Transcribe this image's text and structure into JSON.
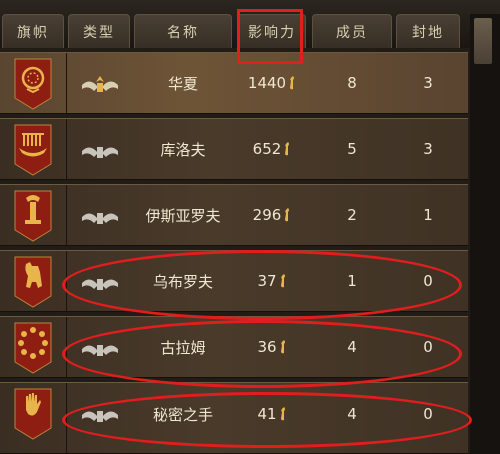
{
  "header": {
    "col_banner": "旗帜",
    "col_type": "类型",
    "col_name": "名称",
    "col_influence": "影响力",
    "col_members": "成员",
    "col_fiefs": "封地"
  },
  "rows": [
    {
      "name": "华夏",
      "influence": "1440",
      "members": "8",
      "fiefs": "3"
    },
    {
      "name": "库洛夫",
      "influence": "652",
      "members": "5",
      "fiefs": "3"
    },
    {
      "name": "伊斯亚罗夫",
      "influence": "296",
      "members": "2",
      "fiefs": "1"
    },
    {
      "name": "乌布罗夫",
      "influence": "37",
      "members": "1",
      "fiefs": "0"
    },
    {
      "name": "古拉姆",
      "influence": "36",
      "members": "4",
      "fiefs": "0"
    },
    {
      "name": "秘密之手",
      "influence": "41",
      "members": "4",
      "fiefs": "0"
    }
  ],
  "colors": {
    "banner_red": "#8e1d12",
    "emblem_gold": "#e7b54a",
    "annotation_red": "#e21d1d"
  },
  "icons": [
    "laurel-wreath-emblem",
    "longship-emblem",
    "tower-emblem",
    "bear-emblem",
    "sun-ring-emblem",
    "open-hand-emblem",
    "clan-type-icon",
    "influence-icon"
  ]
}
